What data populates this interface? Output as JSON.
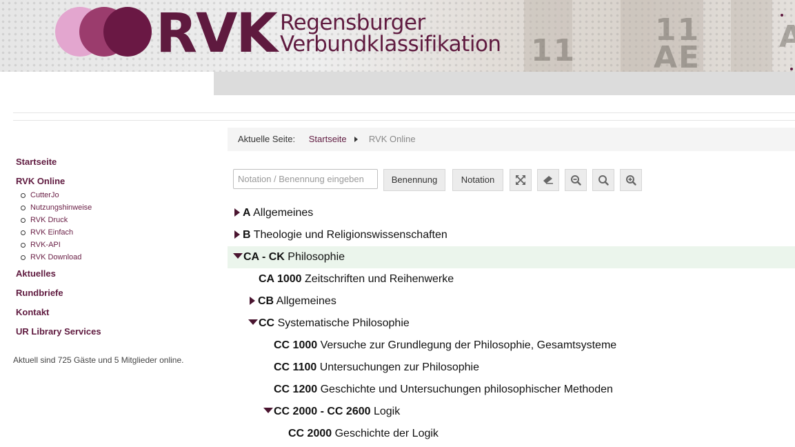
{
  "header": {
    "logo_text": "RVK",
    "subtitle_line1": "Regensburger",
    "subtitle_line2": "Verbundklassifikation",
    "brand_color": "#5f1a3f",
    "accent_colors": [
      "#e3a6cf",
      "#9b3c6d",
      "#6a1844"
    ]
  },
  "sidebar": {
    "items": [
      {
        "label": "Startseite"
      },
      {
        "label": "RVK Online",
        "children": [
          "CutterJo",
          "Nutzungshinweise",
          "RVK Druck",
          "RVK Einfach",
          "RVK-API",
          "RVK Download"
        ]
      },
      {
        "label": "Aktuelles"
      },
      {
        "label": "Rundbriefe"
      },
      {
        "label": "Kontakt"
      },
      {
        "label": "UR Library Services"
      }
    ],
    "online_status": "Aktuell sind 725 Gäste und 5 Mitglieder online."
  },
  "breadcrumb": {
    "prefix": "Aktuelle Seite:",
    "home": "Startseite",
    "current": "RVK Online"
  },
  "toolbar": {
    "search_placeholder": "Notation / Benennung eingeben",
    "search_value": "",
    "benennung_label": "Benennung",
    "notation_label": "Notation",
    "icons": [
      "expand-icon",
      "eraser-icon",
      "zoom-out-icon",
      "search-icon",
      "zoom-in-icon"
    ]
  },
  "tree": [
    {
      "notation": "A",
      "label": "Allgemeines",
      "level": 0,
      "state": "collapsed"
    },
    {
      "notation": "B",
      "label": "Theologie und Religionswissenschaften",
      "level": 0,
      "state": "collapsed"
    },
    {
      "notation": "CA - CK",
      "label": "Philosophie",
      "level": 0,
      "state": "expanded",
      "active": true
    },
    {
      "notation": "CA 1000",
      "label": "Zeitschriften und Reihenwerke",
      "level": 1,
      "state": "leaf"
    },
    {
      "notation": "CB",
      "label": "Allgemeines",
      "level": 1,
      "state": "collapsed"
    },
    {
      "notation": "CC",
      "label": "Systematische Philosophie",
      "level": 1,
      "state": "expanded"
    },
    {
      "notation": "CC 1000",
      "label": "Versuche zur Grundlegung der Philosophie, Gesamtsysteme",
      "level": 2,
      "state": "leaf"
    },
    {
      "notation": "CC 1100",
      "label": "Untersuchungen zur Philosophie",
      "level": 2,
      "state": "leaf"
    },
    {
      "notation": "CC 1200",
      "label": "Geschichte und Untersuchungen philosophischer Methoden",
      "level": 2,
      "state": "leaf"
    },
    {
      "notation": "CC 2000 - CC 2600",
      "label": "Logik",
      "level": 2,
      "state": "expanded"
    },
    {
      "notation": "CC 2000",
      "label": "Geschichte der Logik",
      "level": 3,
      "state": "leaf"
    }
  ]
}
